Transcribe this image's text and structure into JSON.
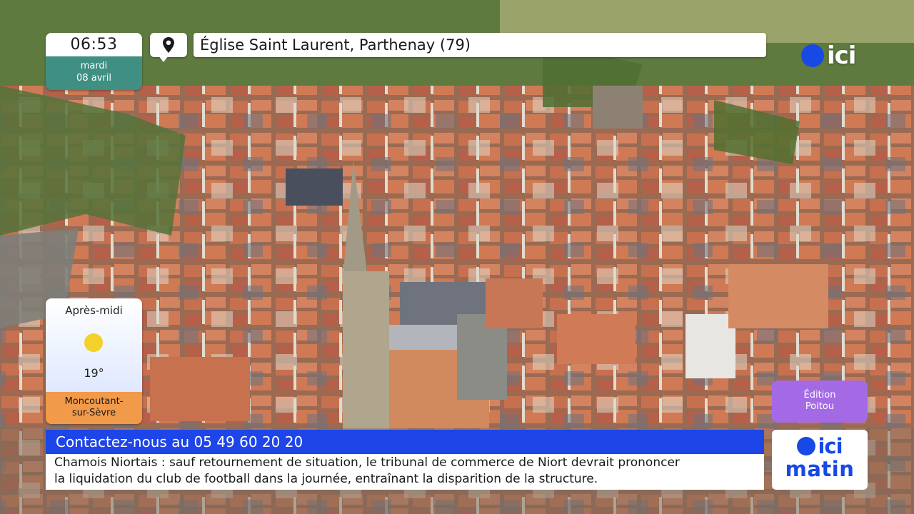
{
  "clock": {
    "time": "06:53",
    "weekday": "mardi",
    "date": "08 avril"
  },
  "location": {
    "icon": "map-pin-icon",
    "title": "Église Saint Laurent, Parthenay (79)"
  },
  "channel_logo": {
    "text": "ici"
  },
  "weather": {
    "period": "Après-midi",
    "icon": "sun-icon",
    "temperature": "19°",
    "city_line1": "Moncoutant-",
    "city_line2": "sur-Sèvre"
  },
  "edition": {
    "line1": "Édition",
    "line2": "Poitou"
  },
  "contact_banner": {
    "text": "Contactez-nous au 05 49 60 20 20"
  },
  "ticker": {
    "line1": "Chamois Niortais : sauf retournement de situation, le tribunal de commerce de Niort devrait prononcer",
    "line2": "la liquidation du club de football dans la journée, entraînant la disparition de la structure."
  },
  "show_logo": {
    "brand": "ici",
    "show": "matin"
  },
  "colors": {
    "brand_blue": "#1749e6",
    "clock_green": "#3f8f82",
    "weather_orange": "#f09a4a",
    "edition_purple": "#a46ae6"
  }
}
